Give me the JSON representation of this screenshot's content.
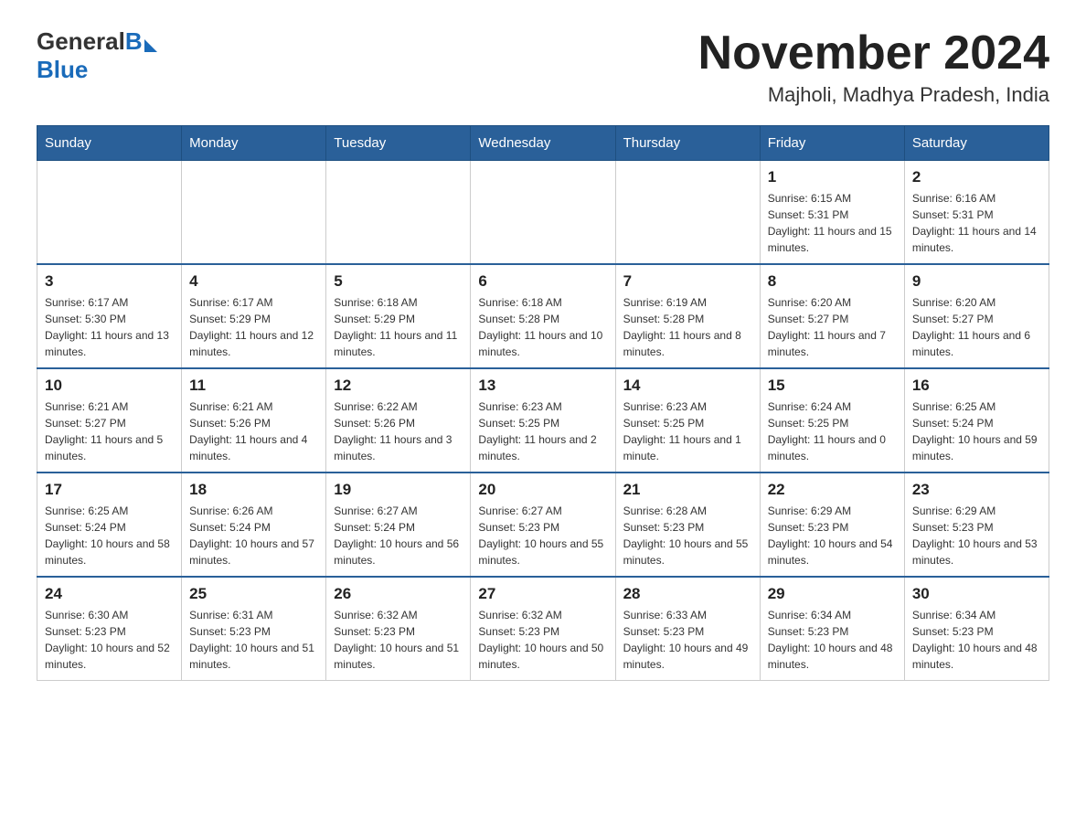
{
  "header": {
    "logo": {
      "general": "General",
      "blue": "Blue"
    },
    "title": "November 2024",
    "location": "Majholi, Madhya Pradesh, India"
  },
  "weekdays": [
    "Sunday",
    "Monday",
    "Tuesday",
    "Wednesday",
    "Thursday",
    "Friday",
    "Saturday"
  ],
  "weeks": [
    [
      {
        "day": "",
        "info": ""
      },
      {
        "day": "",
        "info": ""
      },
      {
        "day": "",
        "info": ""
      },
      {
        "day": "",
        "info": ""
      },
      {
        "day": "",
        "info": ""
      },
      {
        "day": "1",
        "info": "Sunrise: 6:15 AM\nSunset: 5:31 PM\nDaylight: 11 hours and 15 minutes."
      },
      {
        "day": "2",
        "info": "Sunrise: 6:16 AM\nSunset: 5:31 PM\nDaylight: 11 hours and 14 minutes."
      }
    ],
    [
      {
        "day": "3",
        "info": "Sunrise: 6:17 AM\nSunset: 5:30 PM\nDaylight: 11 hours and 13 minutes."
      },
      {
        "day": "4",
        "info": "Sunrise: 6:17 AM\nSunset: 5:29 PM\nDaylight: 11 hours and 12 minutes."
      },
      {
        "day": "5",
        "info": "Sunrise: 6:18 AM\nSunset: 5:29 PM\nDaylight: 11 hours and 11 minutes."
      },
      {
        "day": "6",
        "info": "Sunrise: 6:18 AM\nSunset: 5:28 PM\nDaylight: 11 hours and 10 minutes."
      },
      {
        "day": "7",
        "info": "Sunrise: 6:19 AM\nSunset: 5:28 PM\nDaylight: 11 hours and 8 minutes."
      },
      {
        "day": "8",
        "info": "Sunrise: 6:20 AM\nSunset: 5:27 PM\nDaylight: 11 hours and 7 minutes."
      },
      {
        "day": "9",
        "info": "Sunrise: 6:20 AM\nSunset: 5:27 PM\nDaylight: 11 hours and 6 minutes."
      }
    ],
    [
      {
        "day": "10",
        "info": "Sunrise: 6:21 AM\nSunset: 5:27 PM\nDaylight: 11 hours and 5 minutes."
      },
      {
        "day": "11",
        "info": "Sunrise: 6:21 AM\nSunset: 5:26 PM\nDaylight: 11 hours and 4 minutes."
      },
      {
        "day": "12",
        "info": "Sunrise: 6:22 AM\nSunset: 5:26 PM\nDaylight: 11 hours and 3 minutes."
      },
      {
        "day": "13",
        "info": "Sunrise: 6:23 AM\nSunset: 5:25 PM\nDaylight: 11 hours and 2 minutes."
      },
      {
        "day": "14",
        "info": "Sunrise: 6:23 AM\nSunset: 5:25 PM\nDaylight: 11 hours and 1 minute."
      },
      {
        "day": "15",
        "info": "Sunrise: 6:24 AM\nSunset: 5:25 PM\nDaylight: 11 hours and 0 minutes."
      },
      {
        "day": "16",
        "info": "Sunrise: 6:25 AM\nSunset: 5:24 PM\nDaylight: 10 hours and 59 minutes."
      }
    ],
    [
      {
        "day": "17",
        "info": "Sunrise: 6:25 AM\nSunset: 5:24 PM\nDaylight: 10 hours and 58 minutes."
      },
      {
        "day": "18",
        "info": "Sunrise: 6:26 AM\nSunset: 5:24 PM\nDaylight: 10 hours and 57 minutes."
      },
      {
        "day": "19",
        "info": "Sunrise: 6:27 AM\nSunset: 5:24 PM\nDaylight: 10 hours and 56 minutes."
      },
      {
        "day": "20",
        "info": "Sunrise: 6:27 AM\nSunset: 5:23 PM\nDaylight: 10 hours and 55 minutes."
      },
      {
        "day": "21",
        "info": "Sunrise: 6:28 AM\nSunset: 5:23 PM\nDaylight: 10 hours and 55 minutes."
      },
      {
        "day": "22",
        "info": "Sunrise: 6:29 AM\nSunset: 5:23 PM\nDaylight: 10 hours and 54 minutes."
      },
      {
        "day": "23",
        "info": "Sunrise: 6:29 AM\nSunset: 5:23 PM\nDaylight: 10 hours and 53 minutes."
      }
    ],
    [
      {
        "day": "24",
        "info": "Sunrise: 6:30 AM\nSunset: 5:23 PM\nDaylight: 10 hours and 52 minutes."
      },
      {
        "day": "25",
        "info": "Sunrise: 6:31 AM\nSunset: 5:23 PM\nDaylight: 10 hours and 51 minutes."
      },
      {
        "day": "26",
        "info": "Sunrise: 6:32 AM\nSunset: 5:23 PM\nDaylight: 10 hours and 51 minutes."
      },
      {
        "day": "27",
        "info": "Sunrise: 6:32 AM\nSunset: 5:23 PM\nDaylight: 10 hours and 50 minutes."
      },
      {
        "day": "28",
        "info": "Sunrise: 6:33 AM\nSunset: 5:23 PM\nDaylight: 10 hours and 49 minutes."
      },
      {
        "day": "29",
        "info": "Sunrise: 6:34 AM\nSunset: 5:23 PM\nDaylight: 10 hours and 48 minutes."
      },
      {
        "day": "30",
        "info": "Sunrise: 6:34 AM\nSunset: 5:23 PM\nDaylight: 10 hours and 48 minutes."
      }
    ]
  ]
}
